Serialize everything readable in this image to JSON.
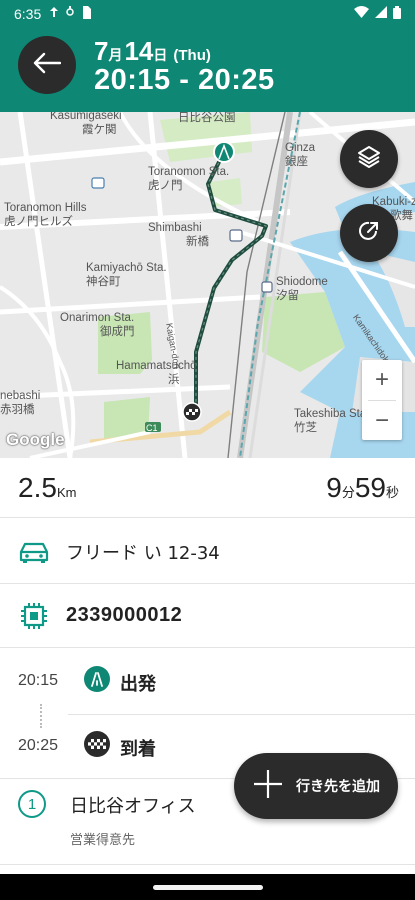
{
  "status_bar": {
    "time": "6:35",
    "left_icons": [
      "notification-icon",
      "usb-icon",
      "sim-icon"
    ],
    "right_icons": [
      "wifi-icon",
      "signal-icon",
      "battery-icon"
    ]
  },
  "header": {
    "month": "7",
    "month_unit": "月",
    "day": "14",
    "day_unit": "日",
    "weekday": "(Thu)",
    "time_range": "20:15 - 20:25",
    "back_icon": "arrow-left-icon"
  },
  "map": {
    "labels": {
      "kasumigaseki": "Kasumigaseki",
      "kasumigaseki_jp": "霞ケ関",
      "hibiya_park": "日比谷公園",
      "toranomon_sta": "Toranomon Sta.",
      "toranomon_sta_jp": "虎ノ門",
      "ginza": "Ginza",
      "ginza_jp": "銀座",
      "toranomon_hills": "Toranomon Hills",
      "toranomon_hills_jp": "虎ノ門ヒルズ",
      "kabuki": "Kabuki-z",
      "kabuki_jp": "歌舞",
      "shimbashi": "Shimbashi",
      "shimbashi_jp": "新橋",
      "kamiyacho": "Kamiyachō Sta.",
      "kamiyacho_jp": "神谷町",
      "shiodome": "Shiodome",
      "shiodome_jp": "汐留",
      "onarimon": "Onarimon Sta.",
      "onarimon_jp": "御成門",
      "kaigan": "Kaigan-dori",
      "kachidoki": "Kamikachidoki",
      "hamamatsucho": "Hamamatsuchō",
      "hamamatsucho_jp": "浜",
      "akabanebashi": "nebashi",
      "akabanebashi_jp": "赤羽橋",
      "takeshiba": "Takeshiba Sta.",
      "takeshiba_jp": "竹芝",
      "route_marker": "C1",
      "google": "Google"
    },
    "layers_icon": "layers-icon",
    "recenter_icon": "recenter-icon",
    "zoom_in": "+",
    "zoom_out": "−",
    "colors": {
      "route": "#1f4d3f",
      "park": "#c7e6b4",
      "water": "#a7d6ef"
    }
  },
  "stats": {
    "distance_value": "2.5",
    "distance_unit": "Km",
    "duration_min": "9",
    "duration_min_unit": "分",
    "duration_sec": "59",
    "duration_sec_unit": "秒"
  },
  "vehicle": {
    "icon": "car-icon",
    "name": "フリード い 12-34"
  },
  "device": {
    "icon": "chip-icon",
    "id": "2339000012"
  },
  "timeline": {
    "depart_time": "20:15",
    "depart_label": "出発",
    "depart_icon": "road-icon",
    "arrive_time": "20:25",
    "arrive_label": "到着",
    "arrive_icon": "checkered-flag-icon"
  },
  "destination": {
    "number": "1",
    "name": "日比谷オフィス",
    "category": "営業得意先"
  },
  "add_destination": {
    "icon": "plus-icon",
    "label": "行き先を追加"
  },
  "theme": {
    "primary": "#0e8774",
    "accent": "#0e9a86",
    "dark_fab": "#2b2b2b"
  }
}
